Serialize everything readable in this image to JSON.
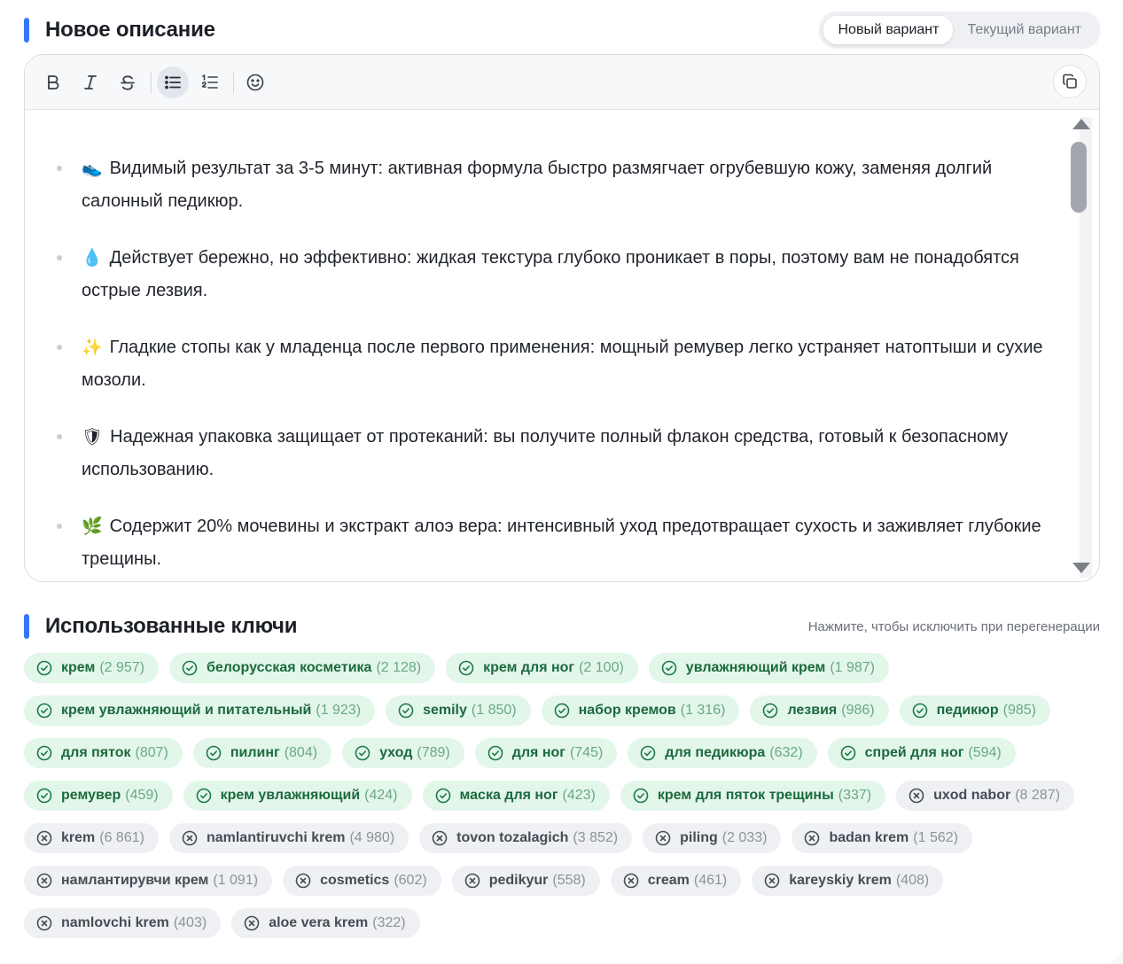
{
  "header": {
    "title": "Новое описание",
    "tabs": [
      {
        "label": "Новый вариант",
        "active": true
      },
      {
        "label": "Текущий вариант",
        "active": false
      }
    ]
  },
  "toolbar": {
    "buttons": [
      "bold-icon",
      "italic-icon",
      "strikethrough-icon",
      "bullet-list-icon",
      "numbered-list-icon",
      "emoji-icon"
    ],
    "active": "bullet-list-icon",
    "copy": "copy-icon"
  },
  "description": [
    {
      "emoji": "👟",
      "text": "Видимый результат за 3-5 минут: активная формула быстро размягчает огрубевшую кожу, заменяя долгий салонный педикюр."
    },
    {
      "emoji": "💧",
      "text": "Действует бережно, но эффективно: жидкая текстура глубоко проникает в поры, поэтому вам не понадобятся острые лезвия."
    },
    {
      "emoji": "✨",
      "text": "Гладкие стопы как у младенца после первого применения: мощный ремувер легко устраняет натоптыши и сухие мозоли."
    },
    {
      "emoji": "🛡",
      "text": "Надежная упаковка защищает от протеканий: вы получите полный флакон средства, готовый к безопасному использованию."
    },
    {
      "emoji": "🌿",
      "text": "Содержит 20% мочевины и экстракт алоэ вера: интенсивный уход предотвращает сухость и заживляет глубокие трещины."
    }
  ],
  "keys_section": {
    "title": "Использованные ключи",
    "hint": "Нажмите, чтобы исключить при перегенерации"
  },
  "colors": {
    "accent": "#3478f6",
    "included_bg": "#e3f6ea",
    "included_fg": "#1c6a3e",
    "excluded_bg": "#eef0f4"
  },
  "keys": [
    {
      "label": "крем",
      "count": "(2 957)",
      "included": true
    },
    {
      "label": "белорусская косметика",
      "count": "(2 128)",
      "included": true
    },
    {
      "label": "крем для ног",
      "count": "(2 100)",
      "included": true
    },
    {
      "label": "увлажняющий крем",
      "count": "(1 987)",
      "included": true
    },
    {
      "label": "крем увлажняющий и питательный",
      "count": "(1 923)",
      "included": true
    },
    {
      "label": "semily",
      "count": "(1 850)",
      "included": true
    },
    {
      "label": "набор кремов",
      "count": "(1 316)",
      "included": true
    },
    {
      "label": "лезвия",
      "count": "(986)",
      "included": true
    },
    {
      "label": "педикюр",
      "count": "(985)",
      "included": true
    },
    {
      "label": "для пяток",
      "count": "(807)",
      "included": true
    },
    {
      "label": "пилинг",
      "count": "(804)",
      "included": true
    },
    {
      "label": "уход",
      "count": "(789)",
      "included": true
    },
    {
      "label": "для ног",
      "count": "(745)",
      "included": true
    },
    {
      "label": "для педикюра",
      "count": "(632)",
      "included": true
    },
    {
      "label": "спрей для ног",
      "count": "(594)",
      "included": true
    },
    {
      "label": "ремувер",
      "count": "(459)",
      "included": true
    },
    {
      "label": "крем увлажняющий",
      "count": "(424)",
      "included": true
    },
    {
      "label": "маска для ног",
      "count": "(423)",
      "included": true
    },
    {
      "label": "крем для пяток трещины",
      "count": "(337)",
      "included": true
    },
    {
      "label": "uxod nabor",
      "count": "(8 287)",
      "included": false
    },
    {
      "label": "krem",
      "count": "(6 861)",
      "included": false
    },
    {
      "label": "namlantiruvchi krem",
      "count": "(4 980)",
      "included": false
    },
    {
      "label": "tovon tozalagich",
      "count": "(3 852)",
      "included": false
    },
    {
      "label": "piling",
      "count": "(2 033)",
      "included": false
    },
    {
      "label": "badan krem",
      "count": "(1 562)",
      "included": false
    },
    {
      "label": "намлантирувчи крем",
      "count": "(1 091)",
      "included": false
    },
    {
      "label": "cosmetics",
      "count": "(602)",
      "included": false
    },
    {
      "label": "pedikyur",
      "count": "(558)",
      "included": false
    },
    {
      "label": "cream",
      "count": "(461)",
      "included": false
    },
    {
      "label": "kareyskiy krem",
      "count": "(408)",
      "included": false
    },
    {
      "label": "namlovchi krem",
      "count": "(403)",
      "included": false
    },
    {
      "label": "aloe vera krem",
      "count": "(322)",
      "included": false
    }
  ]
}
